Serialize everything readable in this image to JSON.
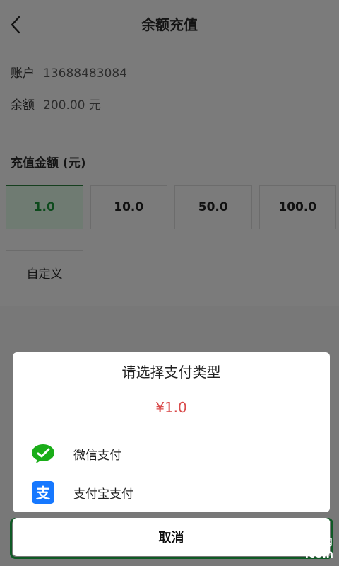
{
  "header": {
    "title": "余额充值"
  },
  "account": {
    "label": "账户",
    "value": "13688483084"
  },
  "balance": {
    "label": "余额",
    "value": "200.00 元"
  },
  "recharge": {
    "section_title": "充值金额 (元)",
    "amounts": [
      "1.0",
      "10.0",
      "50.0",
      "100.0"
    ],
    "selected": "1.0",
    "custom_label": "自定义"
  },
  "dialog": {
    "title": "请选择支付类型",
    "price": "¥1.0",
    "options": [
      {
        "label": "微信支付",
        "icon": "wechat-pay-icon"
      },
      {
        "label": "支付宝支付",
        "icon": "alipay-icon"
      }
    ],
    "cancel_label": "取消"
  },
  "watermark": {
    "number": "2265",
    "cn": "手游网",
    "com": ".com"
  },
  "colors": {
    "accent_green": "#0f5a25",
    "price_red": "#d94a4a",
    "wechat_green": "#1aad19",
    "alipay_blue": "#1678ff"
  }
}
